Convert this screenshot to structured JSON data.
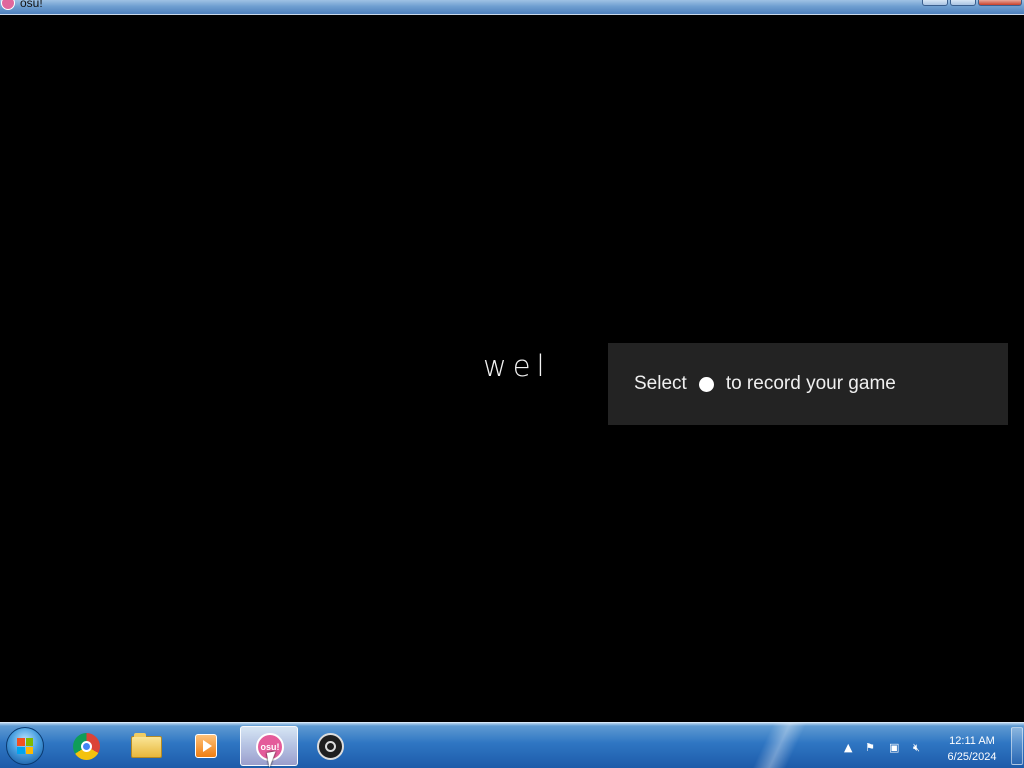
{
  "window": {
    "title": "osu!"
  },
  "game": {
    "intro_text": "wel",
    "toast": {
      "prefix": "Select",
      "suffix": "to record your game",
      "button_icon": "circle-button-icon"
    }
  },
  "taskbar": {
    "apps": [
      {
        "name": "Start",
        "icon": "windows-start-icon"
      },
      {
        "name": "Google Chrome",
        "icon": "chrome-icon"
      },
      {
        "name": "File Explorer",
        "icon": "folder-icon"
      },
      {
        "name": "Media Player",
        "icon": "media-player-icon"
      },
      {
        "name": "osu!",
        "icon": "osu-icon",
        "label": "osu!",
        "active": true
      },
      {
        "name": "OBS Studio",
        "icon": "obs-icon"
      }
    ],
    "tray": {
      "icons": [
        "show-hidden-icons-arrow",
        "action-center-flag-icon",
        "network-icon",
        "volume-muted-icon"
      ],
      "time": "12:11 AM",
      "date": "6/25/2024"
    }
  },
  "colors": {
    "game_background": "#000000",
    "toast_background": "#232323",
    "osu_pink": "#e45b9a",
    "taskbar_blue": "#2f76c3"
  }
}
